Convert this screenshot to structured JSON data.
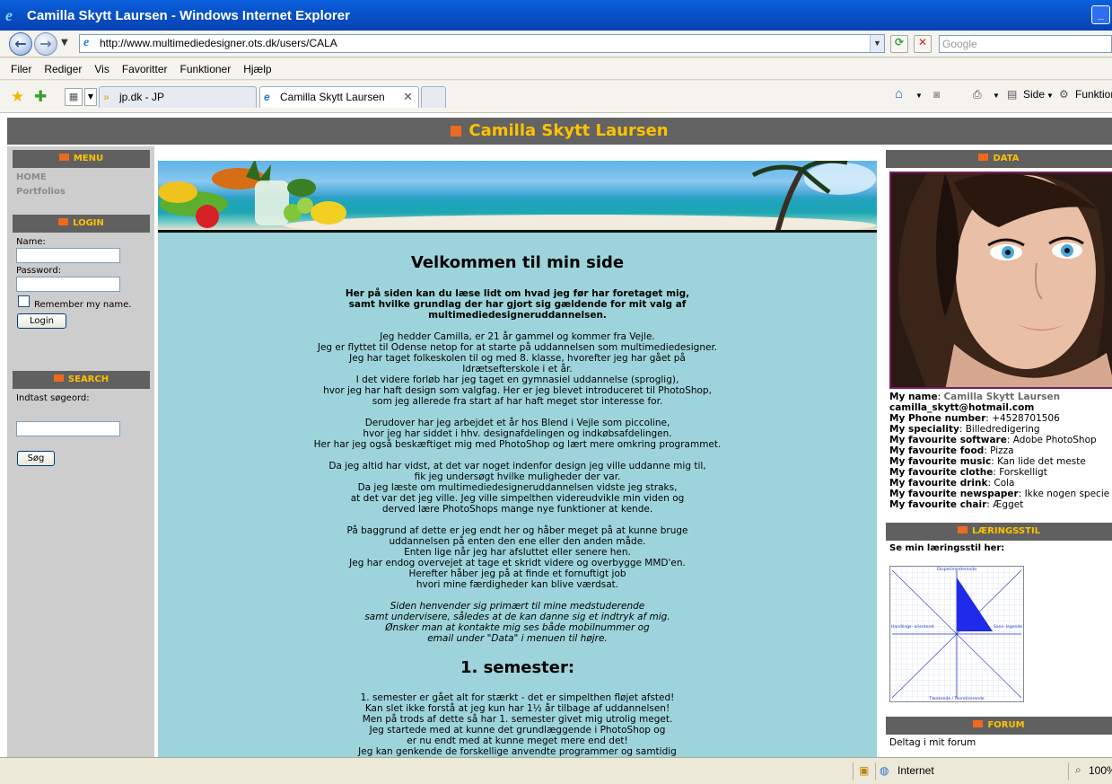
{
  "window": {
    "title": "Camilla Skytt Laursen - Windows Internet Explorer",
    "btn": "_"
  },
  "address": {
    "url": "http://www.multimediedesigner.ots.dk/users/CALA",
    "search_placeholder": "Google"
  },
  "menu": [
    "Filer",
    "Rediger",
    "Vis",
    "Favoritter",
    "Funktioner",
    "Hjælp"
  ],
  "tabs": [
    {
      "label": "jp.dk - JP"
    },
    {
      "label": "Camilla Skytt Laursen"
    }
  ],
  "commands": {
    "side": "Side",
    "funktioner": "Funktion"
  },
  "site": {
    "title": "Camilla Skytt Laursen"
  },
  "left": {
    "menu_head": "MENU",
    "links": [
      "HOME",
      "Portfolios"
    ],
    "login_head": "LOGIN",
    "name_label": "Name:",
    "password_label": "Password:",
    "remember_label": "Remember my name.",
    "login_button": "Login",
    "search_head": "SEARCH",
    "search_label": "Indtast søgeord:",
    "search_button": "Søg"
  },
  "content": {
    "heading1": "Velkommen til min side",
    "intro": "Her på siden kan du læse lidt om hvad jeg før har foretaget mig,\nsamt hvilke grundlag der har gjort sig gældende for mit valg af\nmultimediedesigneruddannelsen.",
    "p1": "Jeg hedder Camilla, er 21 år gammel og kommer fra Vejle.\nJeg er flyttet til Odense netop for at starte på uddannelsen som multimediedesigner.\nJeg har taget folkeskolen til og med 8. klasse, hvorefter jeg har gået på\nIdrætsefterskole i et år.\nI det videre forløb har jeg taget en gymnasiel uddannelse (sproglig),\nhvor jeg har haft design som valgfag. Her er jeg blevet introduceret til PhotoShop,\nsom jeg allerede fra start af har haft meget stor interesse for.",
    "p2": "Derudover har jeg arbejdet et år hos Blend i Vejle som piccoline,\nhvor jeg har siddet i hhv. designafdelingen og indkøbsafdelingen.\nHer har jeg også beskæftiget mig med PhotoShop og lært mere omkring programmet.",
    "p3": "Da jeg altid har vidst, at det var noget indenfor design jeg ville uddanne mig til,\nfik jeg undersøgt hvilke muligheder der var.\nDa jeg læste om multimediedesigneruddannelsen vidste jeg straks,\nat det var det jeg ville. Jeg ville simpelthen videreudvikle min viden og\nderved lære PhotoShops mange nye funktioner at kende.",
    "p4": "På baggrund af dette er jeg endt her og håber meget på at kunne bruge\nuddannelsen på enten den ene eller den anden måde.\nEnten lige når jeg har afsluttet eller senere hen.\nJeg har endog overvejet at tage et skridt videre og overbygge MMD'en.\nHerefter håber jeg på at finde et fornuftigt job\nhvori mine færdigheder kan blive værdsat.",
    "p5": "Siden henvender sig primært til mine medstuderende\nsamt undervisere, således at de kan danne sig et indtryk af mig.\nØnsker man at kontakte mig ses både mobilnummer og\nemail under \"Data\" i menuen til højre.",
    "heading2": "1. semester:",
    "p6": "1. semester er gået alt for stærkt - det er simpelthen fløjet afsted!\nKan slet ikke forstå at jeg kun har 1½ år tilbage af uddannelsen!\nMen på trods af dette så har 1. semester givet mig utrolig meget.\nJeg startede med at kunne det grundlæggende i PhotoShop og\ner nu endt med at kunne meget mere end det!\nJeg kan genkende de forskellige anvendte programmer og samtidig"
  },
  "right": {
    "data_head": "DATA",
    "name_key": "My name",
    "name_value": "Camilla Skytt Laursen",
    "email": "camilla_skytt@hotmail.com",
    "rows": [
      {
        "k": "My Phone number",
        "v": "+4528701506"
      },
      {
        "k": "My speciality",
        "v": "Billedredigering"
      },
      {
        "k": "My favourite software",
        "v": "Adobe PhotoShop"
      },
      {
        "k": "My favourite food",
        "v": "Pizza"
      },
      {
        "k": "My favourite music",
        "v": "Kan lide det meste"
      },
      {
        "k": "My favourite clothe",
        "v": "Forskelligt"
      },
      {
        "k": "My favourite drink",
        "v": "Cola"
      },
      {
        "k": "My favourite newspaper",
        "v": "Ikke nogen specie"
      },
      {
        "k": "My favourite chair",
        "v": "Ægget"
      }
    ],
    "learn_head": "LÆRINGSSTIL",
    "learn_label": "Se min læringsstil her:",
    "chart_labels": {
      "top": "Eksperimenterende",
      "bottom": "Tænkende / Teoretiserende",
      "left": "Handlings-\norienteret",
      "right": "Sans-\nlegende"
    },
    "forum_head": "FORUM",
    "forum_text": "Deltag i mit forum"
  },
  "status": {
    "zone": "Internet",
    "zoom": "100%"
  }
}
